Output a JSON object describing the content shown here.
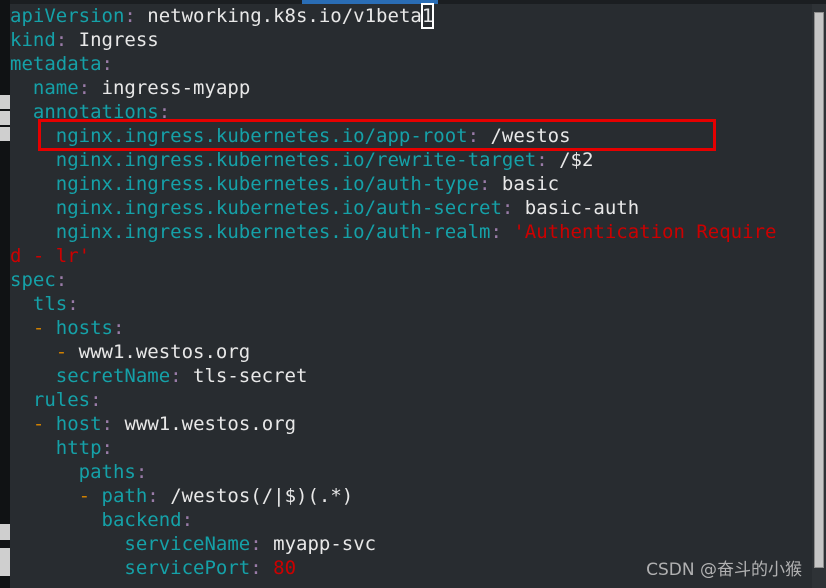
{
  "window": {
    "accent_color": "#2a6db5",
    "background_color": "#282c30",
    "scrollbar_color": "#c6c6c6"
  },
  "editor": {
    "file_type": "yaml",
    "cursor_char": "1",
    "colors": {
      "key": "#15a1a8",
      "punctuation": "#9a7ca8",
      "value": "#e8e8e8",
      "dash": "#d08000",
      "string": "#cc0000",
      "highlight_box": "#e60000"
    },
    "lines": [
      {
        "indent": "",
        "key": "apiVersion",
        "colon": ":",
        "value": " networking.k8s.io/v1beta",
        "cursor": "1"
      },
      {
        "indent": "",
        "key": "kind",
        "colon": ":",
        "value": " Ingress"
      },
      {
        "indent": "",
        "key": "metadata",
        "colon": ":",
        "value": ""
      },
      {
        "indent": "  ",
        "key": "name",
        "colon": ":",
        "value": " ingress-myapp"
      },
      {
        "indent": "  ",
        "key": "annotations",
        "colon": ":",
        "value": ""
      },
      {
        "indent": "    ",
        "key": "nginx.ingress.kubernetes.io/app-root",
        "colon": ":",
        "value": " /westos"
      },
      {
        "indent": "    ",
        "key": "nginx.ingress.kubernetes.io/rewrite-target",
        "colon": ":",
        "value": " /$2"
      },
      {
        "indent": "    ",
        "key": "nginx.ingress.kubernetes.io/auth-type",
        "colon": ":",
        "value": " basic"
      },
      {
        "indent": "    ",
        "key": "nginx.ingress.kubernetes.io/auth-secret",
        "colon": ":",
        "value": " basic-auth"
      },
      {
        "indent": "    ",
        "key": "nginx.ingress.kubernetes.io/auth-realm",
        "colon": ":",
        "string": " 'Authentication Require"
      },
      {
        "wrap": true,
        "string": "d - lr'"
      },
      {
        "indent": "",
        "key": "spec",
        "colon": ":",
        "value": ""
      },
      {
        "indent": "  ",
        "key": "tls",
        "colon": ":",
        "value": ""
      },
      {
        "indent": "  ",
        "dash": "- ",
        "key": "hosts",
        "colon": ":",
        "value": ""
      },
      {
        "indent": "    ",
        "dash": "- ",
        "value": "www1.westos.org"
      },
      {
        "indent": "    ",
        "key": "secretName",
        "colon": ":",
        "value": " tls-secret"
      },
      {
        "indent": "  ",
        "key": "rules",
        "colon": ":",
        "value": ""
      },
      {
        "indent": "  ",
        "dash": "- ",
        "key": "host",
        "colon": ":",
        "value": " www1.westos.org"
      },
      {
        "indent": "    ",
        "key": "http",
        "colon": ":",
        "value": ""
      },
      {
        "indent": "      ",
        "key": "paths",
        "colon": ":",
        "value": ""
      },
      {
        "indent": "      ",
        "dash": "- ",
        "key": "path",
        "colon": ":",
        "value": " /westos(/|$)(.*)"
      },
      {
        "indent": "        ",
        "key": "backend",
        "colon": ":",
        "value": ""
      },
      {
        "indent": "          ",
        "key": "serviceName",
        "colon": ":",
        "value": " myapp-svc"
      },
      {
        "indent": "          ",
        "key": "servicePort",
        "colon": ":",
        "string": " 80"
      }
    ]
  },
  "annotation": {
    "highlight_target": "nginx.ingress.kubernetes.io/app-root: /westos"
  },
  "watermark": {
    "text": "CSDN @奋斗的小猴"
  }
}
